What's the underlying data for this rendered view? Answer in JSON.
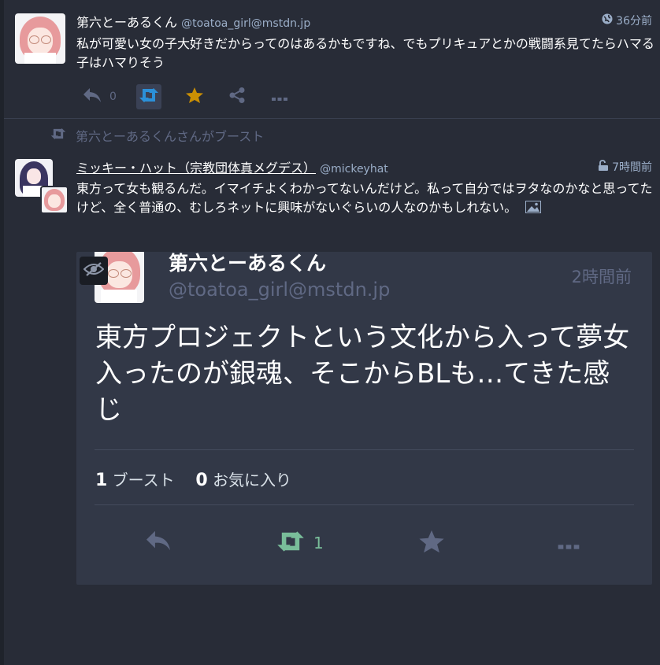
{
  "status1": {
    "display_name": "第六とーあるくん",
    "acct": "@toatoa_girl@mstdn.jp",
    "time": "36分前",
    "content": "私が可愛い女の子大好きだからってのはあるかもですね、でもプリキュアとかの戦闘系見てたらハマる子はハマりそう",
    "reply_count": "0",
    "icons": [
      "globe-icon",
      "reply-icon",
      "boost-icon",
      "star-icon",
      "share-icon",
      "more-icon"
    ]
  },
  "boost_banner": {
    "text": "第六とーあるくんさんがブースト"
  },
  "status2": {
    "display_name": "ミッキー・ハット（宗教団体真メグデス）",
    "acct": "@mickeyhat",
    "time": "7時間前",
    "content": "東方って女も観るんだ。イマイチよくわかってないんだけど。私って自分ではヲタなのかなと思ってたけど、全く普通の、むしろネットに興味がないぐらいの人なのかもしれない。",
    "icons": [
      "unlock-icon",
      "image-icon"
    ]
  },
  "card": {
    "display_name": "第六とーあるくん",
    "acct": "@toatoa_girl@mstdn.jp",
    "time": "2時間前",
    "content": "東方プロジェクトという文化から入って夢女入ったのが銀魂、そこからBLも…てきた感じ",
    "boost_count": "1",
    "boost_label": "ブースト",
    "fav_count": "0",
    "fav_label": "お気に入り",
    "boost_action_count": "1",
    "colors": {
      "boosted": "#79bd9a",
      "muted": "#606984",
      "background": "#323847"
    }
  },
  "colors": {
    "background": "#282c37",
    "secondary_text": "#9baec8",
    "action_icon": "#606984",
    "boost_active": "#2b90d9",
    "star_active": "#ca8f04"
  }
}
